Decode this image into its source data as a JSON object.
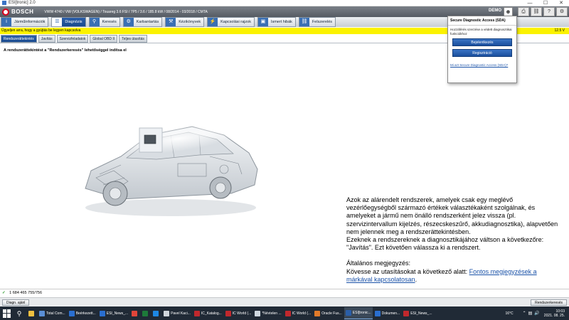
{
  "window": {
    "title": "ESI[tronic] 2.0",
    "controls": [
      "—",
      "☐",
      "✕"
    ]
  },
  "header": {
    "brand": "BOSCH",
    "vehicle": "VWW 4740 / VW (VOLKSWAGEN) / Touareg 3.6 FSI / 7P5 / 3.6 / 185.8 kW / 08/2014 - 03/2018 / CMTA",
    "demo": "DEMO",
    "user_icon": "user-icon",
    "icons": [
      "print-icon",
      "car-icon",
      "help-icon",
      "settings-icon",
      "window-icon"
    ]
  },
  "nav": {
    "tabs": [
      {
        "label": "Járműinformációk",
        "icon": "info-icon",
        "active": false
      },
      {
        "label": "Diagnózis",
        "icon": "diagnosis-icon",
        "active": true
      },
      {
        "label": "Keresés",
        "icon": "search-icon",
        "active": false
      },
      {
        "label": "Karbantartás",
        "icon": "gear-icon",
        "active": false
      },
      {
        "label": "Kézikönyvek",
        "icon": "wrench-icon",
        "active": false
      },
      {
        "label": "Kapcsolási rajzok",
        "icon": "circuit-icon",
        "active": false
      },
      {
        "label": "Ismert hibák",
        "icon": "monitor-icon",
        "active": false
      },
      {
        "label": "Felszerelés",
        "icon": "car-icon",
        "active": false
      }
    ]
  },
  "message_bar": {
    "text": "Ügyeljen arra, hogy a gyújtás be legyen kapcsolva",
    "voltage": "12.5 V"
  },
  "subtabs": [
    {
      "label": "Rendszerättekintés",
      "active": true
    },
    {
      "label": "Javítás",
      "active": false
    },
    {
      "label": "Szervizfeladatok",
      "active": false
    },
    {
      "label": "Global OBD II",
      "active": false
    },
    {
      "label": "Teljes útasítás",
      "active": false
    }
  ],
  "content": {
    "title": "A rendszerättekintést a \"Rendszerkeresés\" lehetőséggel indítsa el",
    "paragraph1": "Azok az alárendelt rendszerek, amelyek csak egy meglévő vezérlőegységből származó értékek választékaként szolgálnak, és amelyeket a jármű nem önálló rendszerként jelez vissza (pl. szervizintervallum kijelzés, részecskeszűrő, akkudiagnosztika), alapvetően nem jelennek meg a rendszerättekintésben.",
    "paragraph2": "Ezeknek a rendszereknek a diagnosztikájához váltson a következőre: \"Javítás\". Ezt követően válassza ki a rendszert.",
    "note_heading": "Általános megjegyzés:",
    "note_text": "Kövesse az utasításokat a következő alatt: ",
    "note_link": "Fontos megjegyzések a márkával kapcsolatosan",
    "note_end": "."
  },
  "sda": {
    "title": "Secure Diagnostic Access (SDA)",
    "description": "Hozzáférés szerzése a védett diagnosztikai funkciókhoz",
    "login_button": "Bejelentkezés",
    "register_button": "Regisztráció",
    "link": "Mi azt Secure Diagnostic Access (SDA)?"
  },
  "status": {
    "check": "✓",
    "value": "1 684 465 755/756"
  },
  "appbar": {
    "left_button": "Diagn. ajánl",
    "right_button": "Rendszerkeresés"
  },
  "taskbar": {
    "items": [
      {
        "label": "",
        "color": "#f0c040"
      },
      {
        "label": "Total Com...",
        "color": "#5a8fd6"
      },
      {
        "label": "Beérkezett...",
        "color": "#2a6fd0"
      },
      {
        "label": "ESI_News_...",
        "color": "#2a6fd0"
      },
      {
        "label": "",
        "color": "#e0453a"
      },
      {
        "label": "",
        "color": "#1d7a3a"
      },
      {
        "label": "",
        "color": "#1e88e5"
      },
      {
        "label": "Pavel Kaci...",
        "color": "#d0d6dc"
      },
      {
        "label": "IC_Katalog...",
        "color": "#c0282d"
      },
      {
        "label": "IC World (...",
        "color": "#c0282d"
      },
      {
        "label": "*Névtelen ...",
        "color": "#cfd8e0"
      },
      {
        "label": "IC World (...",
        "color": "#c0282d"
      },
      {
        "label": "Oracle Fus...",
        "color": "#e07a2a"
      },
      {
        "label": "ESI[tronic...",
        "color": "#2a5ea8",
        "active": true
      },
      {
        "label": "Dokumen...",
        "color": "#2a6fd0"
      },
      {
        "label": "ESI_News_...",
        "color": "#c0282d"
      }
    ],
    "temperature": "16°C",
    "time": "10:03",
    "date": "2021. 08. 25."
  }
}
